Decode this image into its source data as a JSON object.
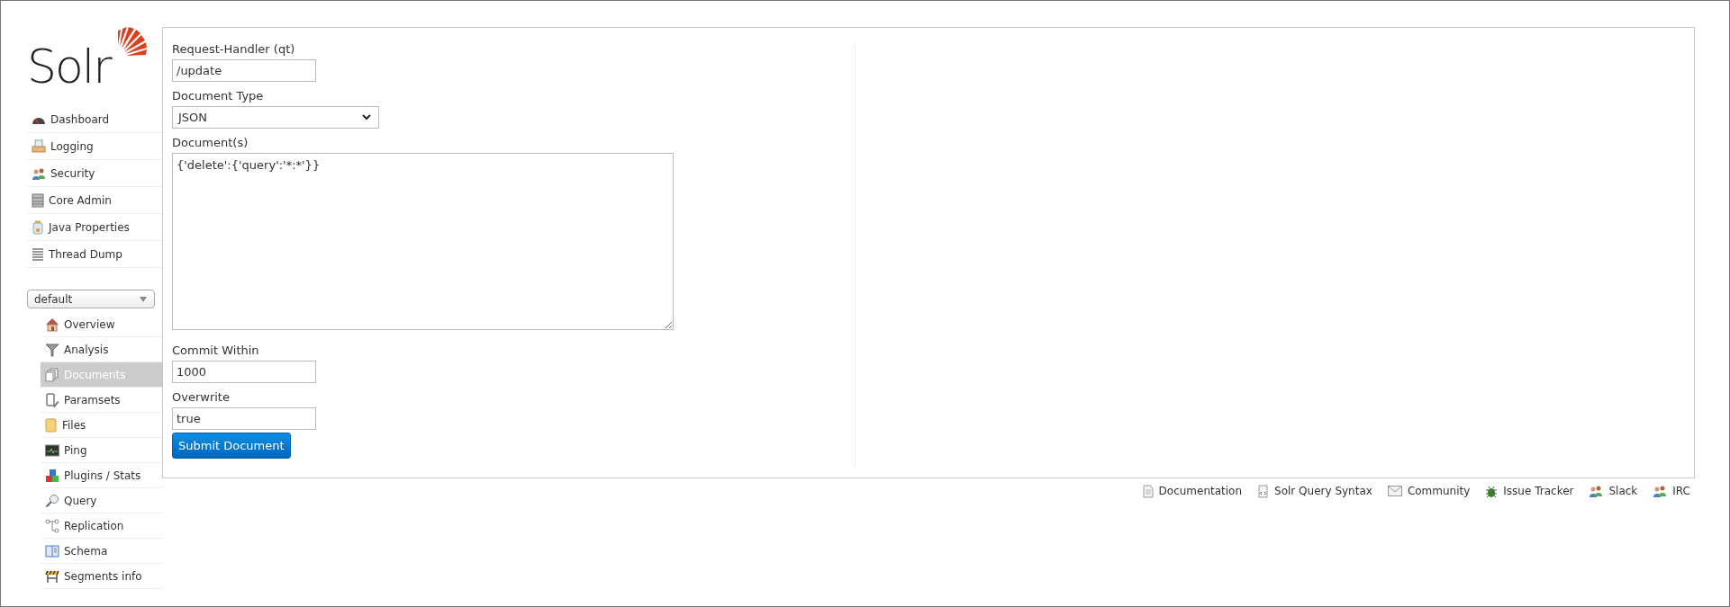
{
  "logo": {
    "text": "Solr"
  },
  "nav": [
    {
      "label": "Dashboard",
      "selected": false
    },
    {
      "label": "Logging",
      "selected": false
    },
    {
      "label": "Security",
      "selected": false
    },
    {
      "label": "Core Admin",
      "selected": false
    },
    {
      "label": "Java Properties",
      "selected": false
    },
    {
      "label": "Thread Dump",
      "selected": false
    }
  ],
  "core_selector": {
    "value": "default"
  },
  "core_menu": [
    {
      "label": "Overview",
      "selected": false
    },
    {
      "label": "Analysis",
      "selected": false
    },
    {
      "label": "Documents",
      "selected": true
    },
    {
      "label": "Paramsets",
      "selected": false
    },
    {
      "label": "Files",
      "selected": false
    },
    {
      "label": "Ping",
      "selected": false
    },
    {
      "label": "Plugins / Stats",
      "selected": false
    },
    {
      "label": "Query",
      "selected": false
    },
    {
      "label": "Replication",
      "selected": false
    },
    {
      "label": "Schema",
      "selected": false
    },
    {
      "label": "Segments info",
      "selected": false
    }
  ],
  "form": {
    "fields": [
      {
        "kind": "input",
        "label": "Request-Handler (qt)",
        "value": "/update"
      },
      {
        "kind": "select",
        "label": "Document Type",
        "value": "JSON"
      },
      {
        "kind": "textarea",
        "label": "Document(s)",
        "value": "{'delete':{'query':'*:*'}}"
      },
      {
        "kind": "input",
        "label": "Commit Within",
        "value": "1000"
      },
      {
        "kind": "input",
        "label": "Overwrite",
        "value": "true"
      }
    ],
    "submit": "Submit Document"
  },
  "footer_links": [
    "Documentation",
    "Solr Query Syntax",
    "Community",
    "Issue Tracker",
    "Slack",
    "IRC"
  ]
}
